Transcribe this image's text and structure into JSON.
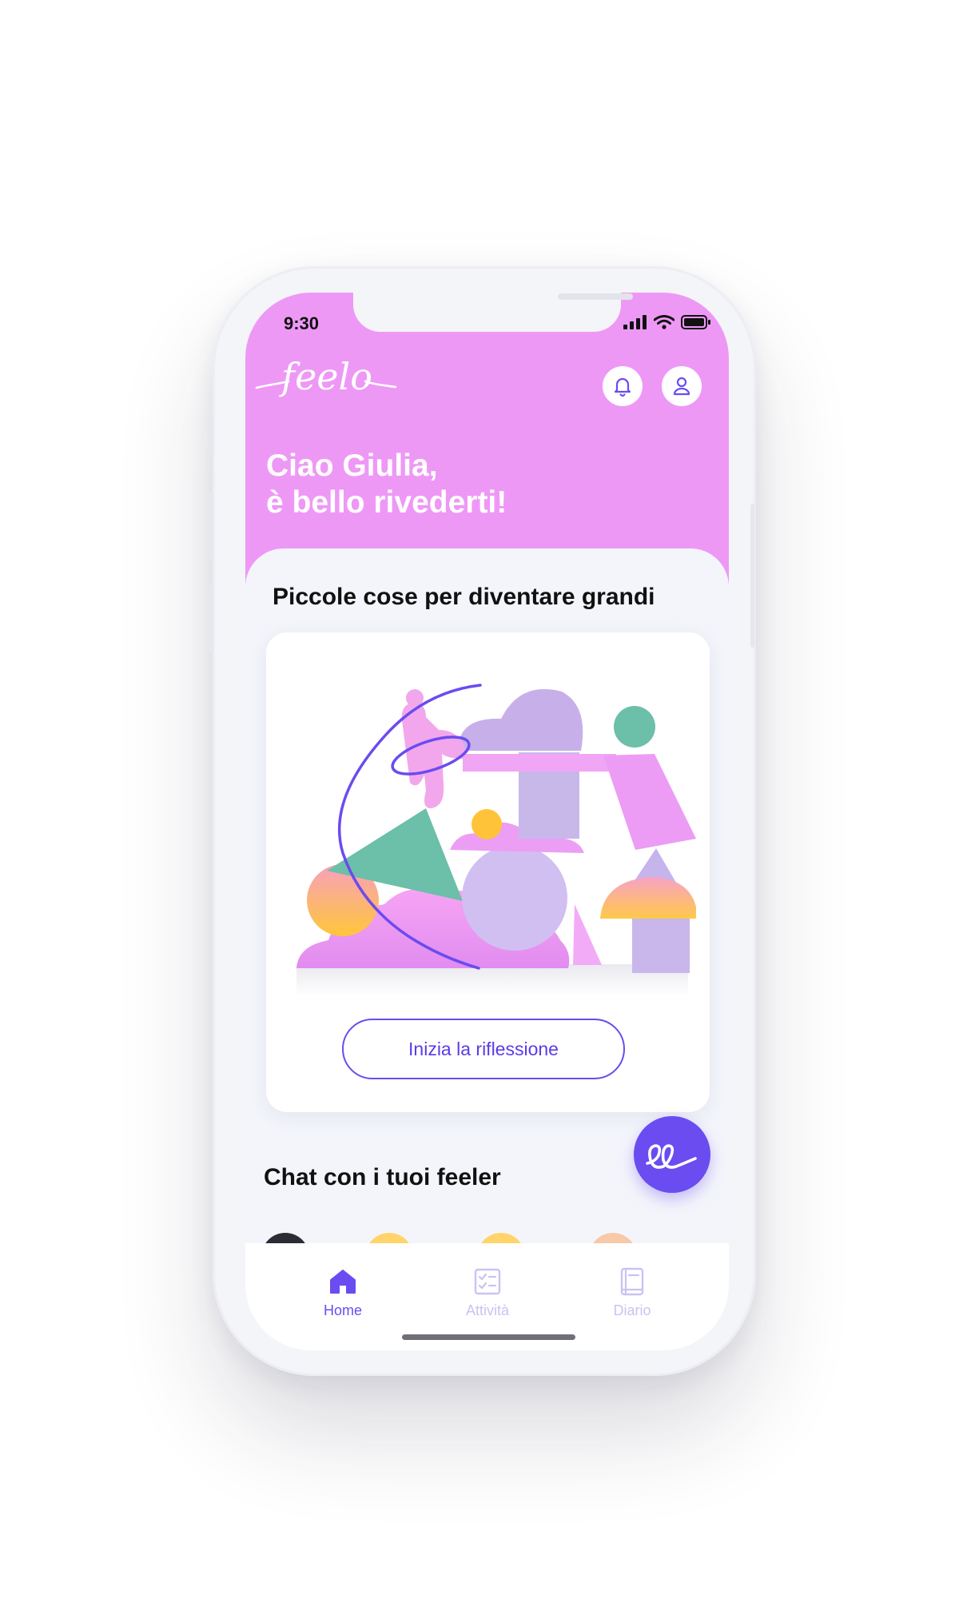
{
  "status_bar": {
    "time": "9:30"
  },
  "header": {
    "logo_text": "feelo",
    "greeting_line1": "Ciao Giulia,",
    "greeting_line2": "è bello rivederti!",
    "notification_icon": "bell-icon",
    "profile_icon": "user-icon"
  },
  "reflection": {
    "title": "Piccole cose per diventare grandi",
    "button_label": "Inizia la riflessione"
  },
  "chat": {
    "title": "Chat con i tuoi feeler",
    "fab_icon": "feelo-chat-icon"
  },
  "tabs": [
    {
      "label": "Home",
      "icon": "home-icon",
      "active": true
    },
    {
      "label": "Attività",
      "icon": "checklist-icon",
      "active": false
    },
    {
      "label": "Diario",
      "icon": "book-icon",
      "active": false
    }
  ],
  "colors": {
    "header_pink": "#ee98f6",
    "accent_purple": "#6a4cf1",
    "inactive_tab": "#c9c3f3",
    "background": "#f3f5fb"
  }
}
